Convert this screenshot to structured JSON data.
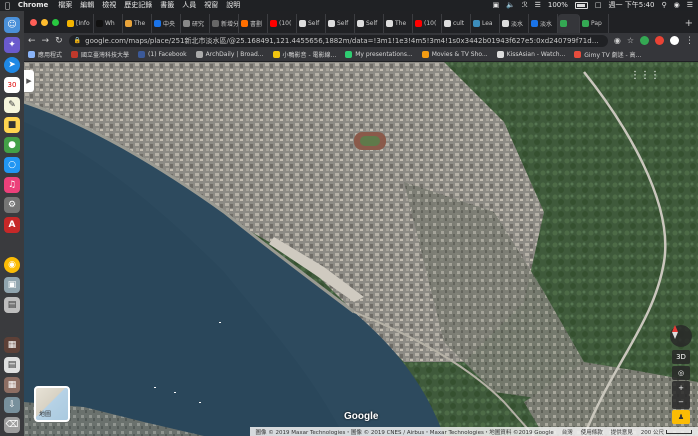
{
  "menubar": {
    "app": "Chrome",
    "items": [
      "檔案",
      "編輯",
      "檢視",
      "歷史記錄",
      "書籤",
      "人員",
      "視窗",
      "說明"
    ],
    "battery": "100%",
    "clock": "週一 下午5:40"
  },
  "tabs": [
    {
      "label": "[Info",
      "color": "#f4b400"
    },
    {
      "label": "Wh",
      "color": "#111111"
    },
    {
      "label": "The",
      "color": "#e8a33a"
    },
    {
      "label": "中央",
      "color": "#1a73e8"
    },
    {
      "label": "研究",
      "color": "#888888"
    },
    {
      "label": "新增分頁",
      "color": "#666666"
    },
    {
      "label": "書劃",
      "color": "#ff6f00"
    },
    {
      "label": "(10(",
      "color": "#ff0000"
    },
    {
      "label": "Self",
      "color": "#dddddd"
    },
    {
      "label": "Self",
      "color": "#dddddd"
    },
    {
      "label": "Self",
      "color": "#dddddd"
    },
    {
      "label": "The",
      "color": "#dddddd"
    },
    {
      "label": "(10(",
      "color": "#ff0000"
    },
    {
      "label": "cult",
      "color": "#dddddd"
    },
    {
      "label": "Lea",
      "color": "#3c8dbc"
    },
    {
      "label": "淡水",
      "color": "#dddddd"
    },
    {
      "label": "淡水",
      "color": "#1a73e8"
    },
    {
      "label": "",
      "color": "#34a853",
      "active": true
    },
    {
      "label": "Pap",
      "color": "#34a853"
    }
  ],
  "toolbar": {
    "url": "google.com/maps/place/251新北市淡水區/@25.168491,121.4455656,1882m/data=!3m1!1e3!4m5!3m4!1s0x3442b01943f627e5:0xd240799f71d07db2!..."
  },
  "bookmarks": [
    {
      "label": "應用程式",
      "color": "#8ab4f8"
    },
    {
      "label": "國立臺灣科技大學",
      "color": "#c0392b"
    },
    {
      "label": "(1) Facebook",
      "color": "#3b5998"
    },
    {
      "label": "ArchDaily | Broad...",
      "color": "#aaaaaa"
    },
    {
      "label": "小鴨影音 - 電影線...",
      "color": "#f1c40f"
    },
    {
      "label": "My presentations...",
      "color": "#2ecc71"
    },
    {
      "label": "Movies & TV Sho...",
      "color": "#f39c12"
    },
    {
      "label": "KissAsian - Watch...",
      "color": "#dddddd"
    },
    {
      "label": "Gimy TV 劇迷 - 高...",
      "color": "#e74c3c"
    }
  ],
  "map": {
    "layers_label": "地圖",
    "logo": "Google",
    "view_3d": "3D",
    "footer": {
      "attribution": "圖像 © 2019 Maxar Technologies・圖像 © 2019 CNES / Airbus・Maxar Technologies・地圖資料 ©2019 Google",
      "region": "台灣",
      "terms": "使用條款",
      "feedback": "提供意見",
      "scale": "200 公尺"
    }
  }
}
